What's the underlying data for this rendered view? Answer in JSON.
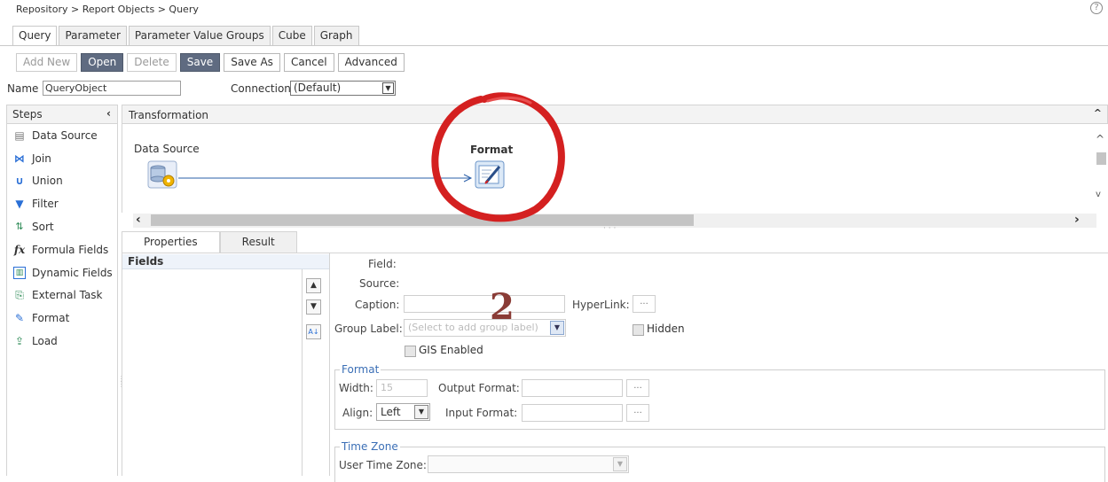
{
  "breadcrumb": "Repository > Report Objects > Query",
  "help_icon": "?",
  "tabs": [
    {
      "label": "Query",
      "active": true
    },
    {
      "label": "Parameter",
      "active": false
    },
    {
      "label": "Parameter Value Groups",
      "active": false
    },
    {
      "label": "Cube",
      "active": false
    },
    {
      "label": "Graph",
      "active": false
    }
  ],
  "toolbar": {
    "add_new": "Add New",
    "open": "Open",
    "delete": "Delete",
    "save": "Save",
    "save_as": "Save As",
    "cancel": "Cancel",
    "advanced": "Advanced"
  },
  "name": {
    "label": "Name",
    "value": "QueryObject"
  },
  "connection": {
    "label": "Connection",
    "value": "(Default)"
  },
  "steps": {
    "title": "Steps",
    "items": [
      {
        "label": "Data Source",
        "icon": "database-icon"
      },
      {
        "label": "Join",
        "icon": "join-icon"
      },
      {
        "label": "Union",
        "icon": "union-icon"
      },
      {
        "label": "Filter",
        "icon": "filter-icon"
      },
      {
        "label": "Sort",
        "icon": "sort-icon"
      },
      {
        "label": "Formula Fields",
        "icon": "formula-icon"
      },
      {
        "label": "Dynamic Fields",
        "icon": "dynamic-fields-icon"
      },
      {
        "label": "External Task",
        "icon": "external-task-icon"
      },
      {
        "label": "Format",
        "icon": "format-icon"
      },
      {
        "label": "Load",
        "icon": "load-icon"
      }
    ]
  },
  "transformation": {
    "title": "Transformation",
    "nodes": {
      "data_source": "Data Source",
      "format": "Format"
    }
  },
  "bottom_tabs": [
    {
      "label": "Properties",
      "active": true
    },
    {
      "label": "Result",
      "active": false
    }
  ],
  "fields_panel": {
    "title": "Fields"
  },
  "properties": {
    "field_label": "Field:",
    "source_label": "Source:",
    "caption_label": "Caption:",
    "hyperlink_label": "HyperLink:",
    "group_label_label": "Group Label:",
    "group_label_placeholder": "(Select to add group label)",
    "hidden_label": "Hidden",
    "gis_label": "GIS Enabled",
    "ellipsis": "...",
    "format": {
      "legend": "Format",
      "width_label": "Width:",
      "width_value": "15",
      "output_format_label": "Output Format:",
      "align_label": "Align:",
      "align_value": "Left",
      "input_format_label": "Input Format:"
    },
    "time_zone": {
      "legend": "Time Zone",
      "user_time_zone_label": "User Time Zone:"
    }
  },
  "annotation_number": "2",
  "colors": {
    "primary_button": "#5f6b81",
    "annotation_red": "#d42020",
    "legend_blue": "#3b6fb6"
  }
}
